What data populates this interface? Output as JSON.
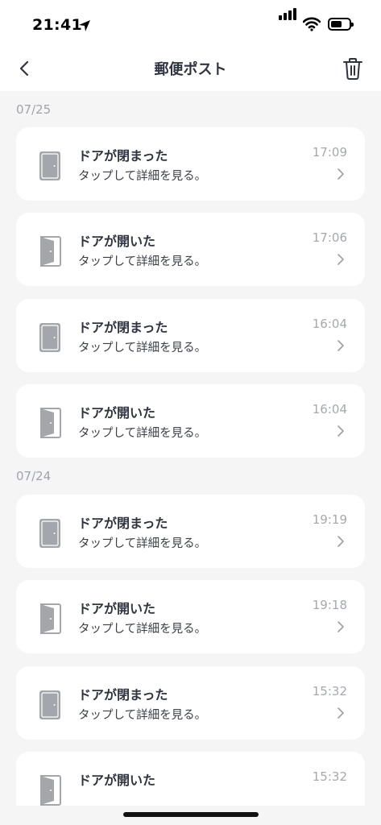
{
  "status_bar": {
    "time": "21:41"
  },
  "header": {
    "title": "郵便ポスト",
    "back_icon": "chevron-left-icon",
    "trash_icon": "trash-icon"
  },
  "sections": [
    {
      "date": "07/25",
      "events": [
        {
          "title": "ドアが閉まった",
          "subtitle": "タップして詳細を見る。",
          "time": "17:09",
          "state": "closed"
        },
        {
          "title": "ドアが開いた",
          "subtitle": "タップして詳細を見る。",
          "time": "17:06",
          "state": "open"
        },
        {
          "title": "ドアが閉まった",
          "subtitle": "タップして詳細を見る。",
          "time": "16:04",
          "state": "closed"
        },
        {
          "title": "ドアが開いた",
          "subtitle": "タップして詳細を見る。",
          "time": "16:04",
          "state": "open"
        }
      ]
    },
    {
      "date": "07/24",
      "events": [
        {
          "title": "ドアが閉まった",
          "subtitle": "タップして詳細を見る。",
          "time": "19:19",
          "state": "closed"
        },
        {
          "title": "ドアが開いた",
          "subtitle": "タップして詳細を見る。",
          "time": "19:18",
          "state": "open"
        },
        {
          "title": "ドアが閉まった",
          "subtitle": "タップして詳細を見る。",
          "time": "15:32",
          "state": "closed"
        },
        {
          "title": "ドアが開いた",
          "subtitle": "",
          "time": "15:32",
          "state": "open"
        }
      ]
    }
  ],
  "colors": {
    "icon": "#a3a6ab",
    "background": "#f5f5f5",
    "card": "#ffffff"
  }
}
